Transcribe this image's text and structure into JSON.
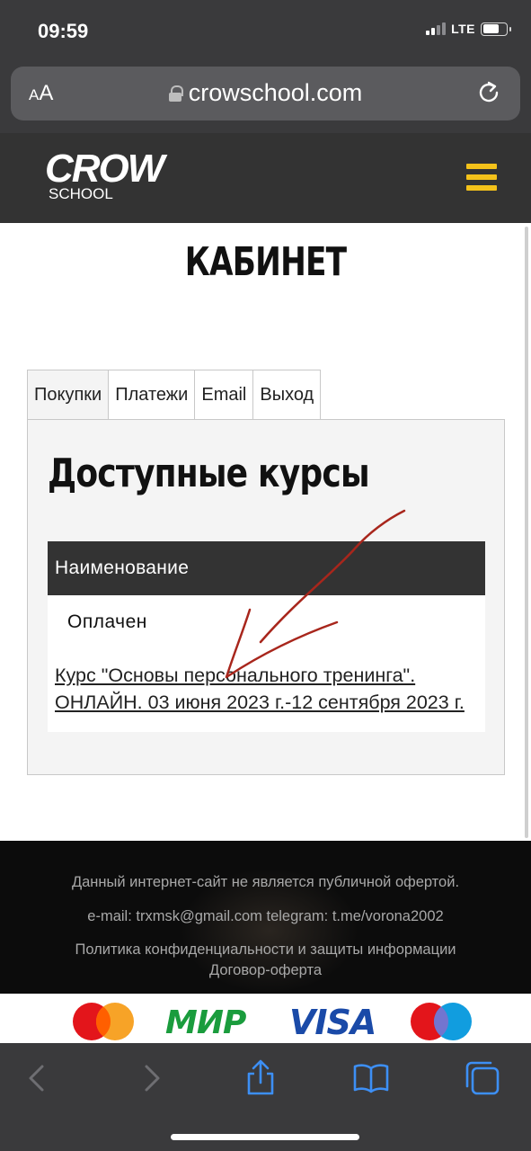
{
  "status_bar": {
    "time": "09:59",
    "network": "LTE"
  },
  "browser": {
    "text_size_label": "AA",
    "url": "crowschool.com"
  },
  "site": {
    "logo_top": "CROW",
    "logo_bottom": "SCHOOL"
  },
  "page": {
    "title": "КАБИНЕТ",
    "tabs": [
      {
        "label": "Покупки",
        "active": true
      },
      {
        "label": "Платежи",
        "active": false
      },
      {
        "label": "Email",
        "active": false
      },
      {
        "label": "Выход",
        "active": false
      }
    ],
    "section_title": "Доступные курсы",
    "table": {
      "header": "Наименование",
      "rows": [
        {
          "status": "Оплачен",
          "course": "Курс \"Основы персонального тренинга\". ОНЛАЙН. 03 июня 2023 г.-12 сентября 2023 г."
        }
      ]
    }
  },
  "footer": {
    "disclaimer": "Данный интернет-сайт не является публичной офертой.",
    "contacts": "e-mail: trxmsk@gmail.com telegram: t.me/vorona2002",
    "privacy_link": "Политика конфиденциальности и защиты информации",
    "offer_link": "Договор-оферта"
  },
  "payments": {
    "mir": "МИР",
    "visa": "VISA"
  },
  "colors": {
    "accent": "#f4c21a",
    "header_bg": "#333333",
    "annotation": "#a8261c"
  }
}
